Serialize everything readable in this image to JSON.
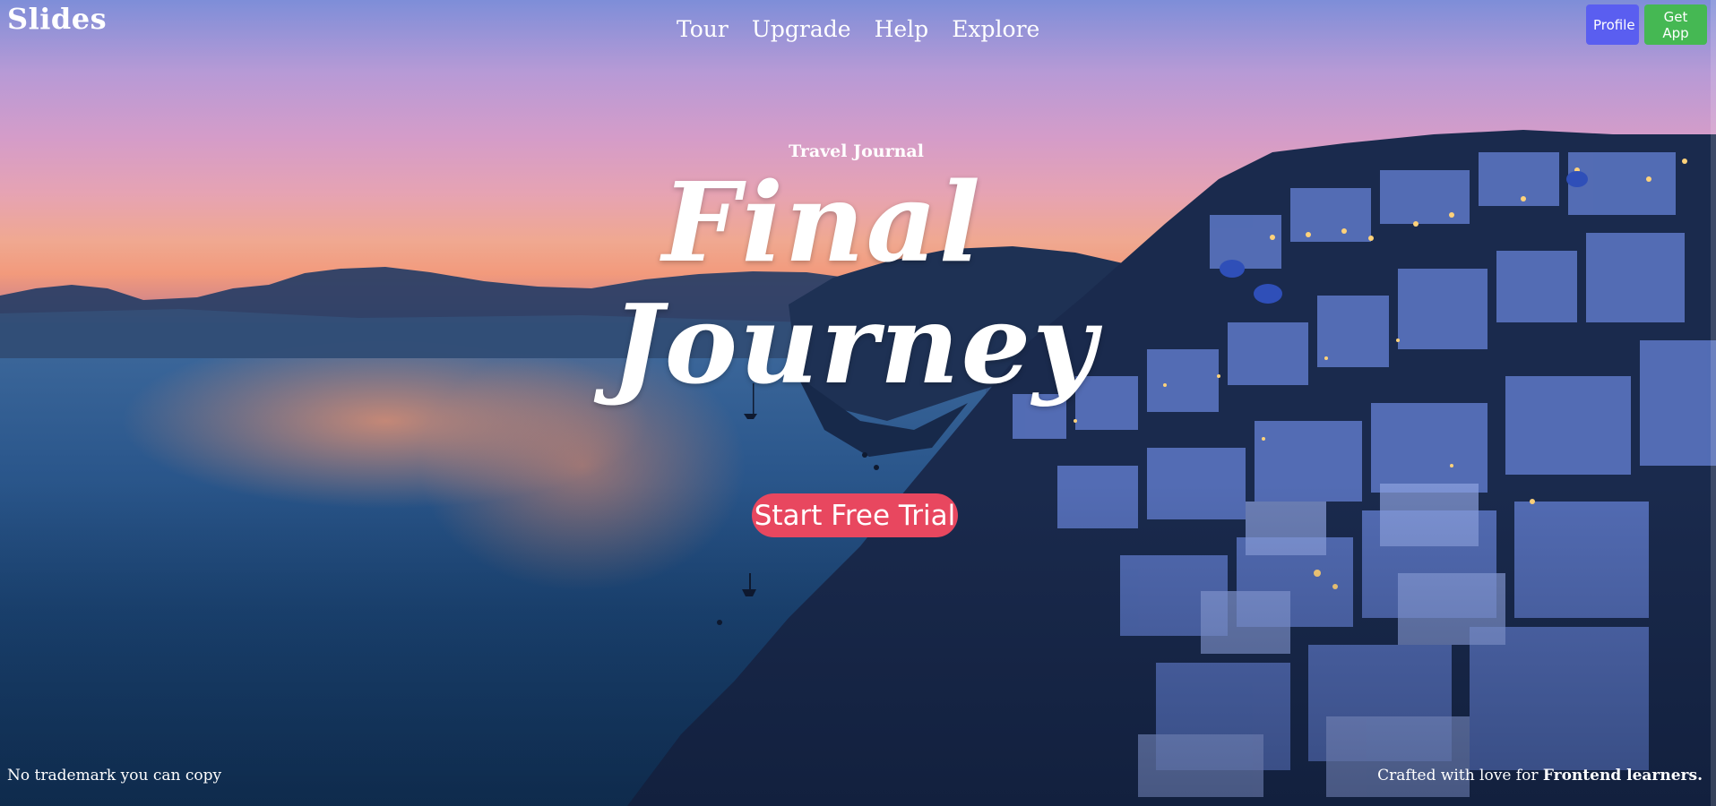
{
  "header": {
    "brand": "Slides",
    "nav": [
      "Tour",
      "Upgrade",
      "Help",
      "Explore"
    ],
    "actions": {
      "profile_label": "Profile",
      "get_app_label": "Get App"
    }
  },
  "hero": {
    "eyebrow": "Travel Journal",
    "title_line1": "Final",
    "title_line2": "Journey",
    "cta_label": "Start Free Trial"
  },
  "footer": {
    "left_text": "No trademark you can copy",
    "right_prefix": "Crafted with love for ",
    "right_emphasis": "Frontend learners."
  },
  "colors": {
    "profile_button": "#5a5ef0",
    "get_app_button": "#45b853",
    "cta_button": "#e8475f",
    "text": "#ffffff"
  },
  "background": {
    "icon": "sunset-coastal-village-photo"
  }
}
